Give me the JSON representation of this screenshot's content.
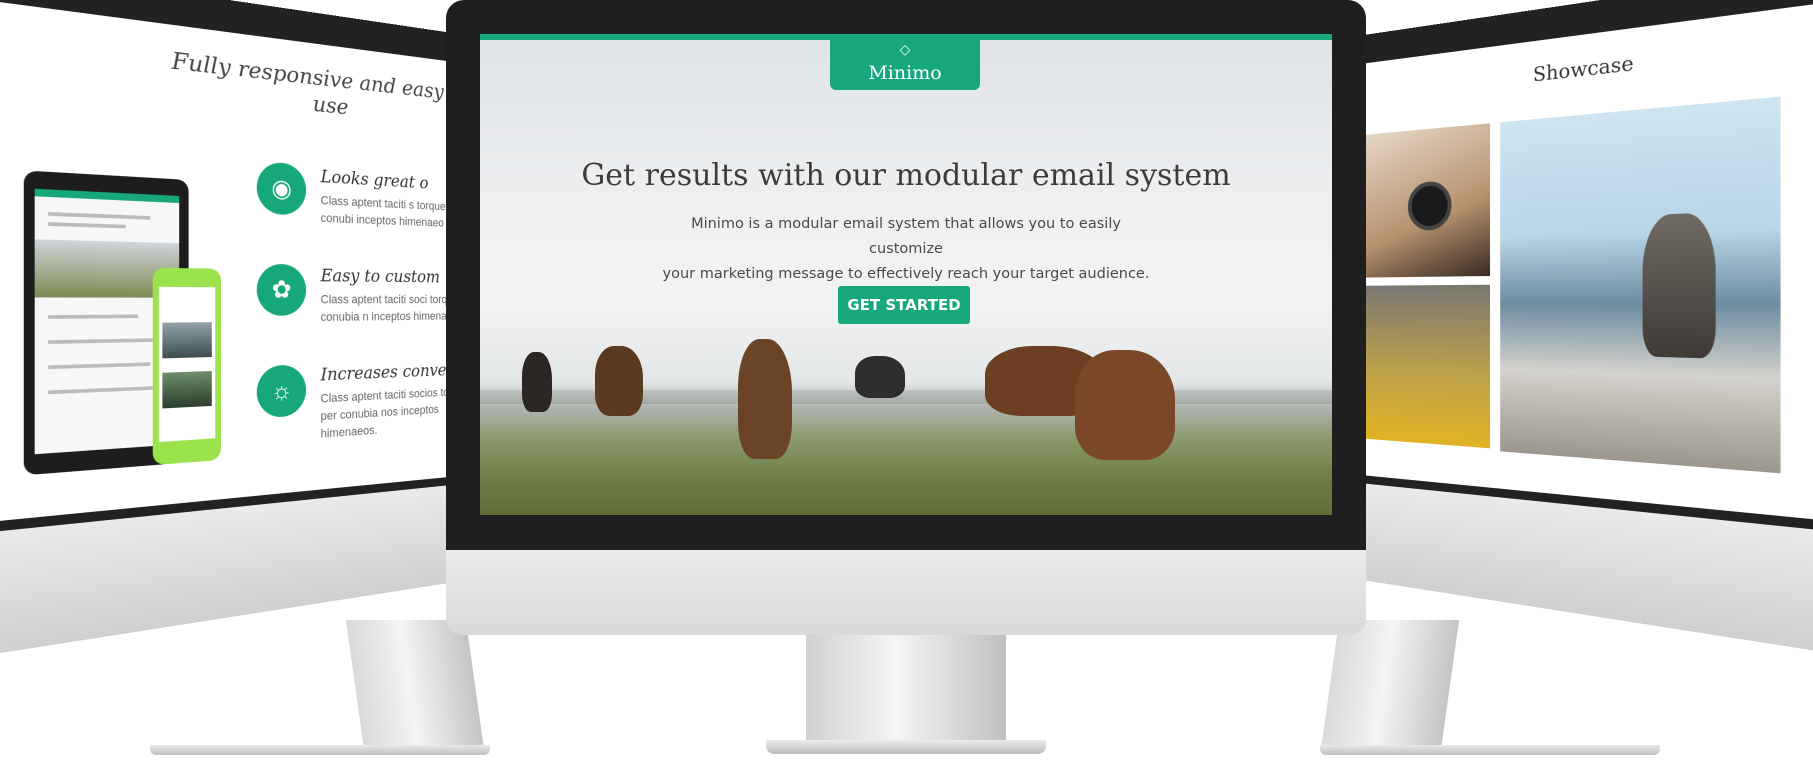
{
  "center_screen": {
    "logo": {
      "icon": "diamond-icon",
      "name": "Minimo"
    },
    "headline": "Get results with our modular email system",
    "description_line1": "Minimo is a modular email system that allows you to easily customize",
    "description_line2": "your marketing message to effectively reach your target audience.",
    "cta_label": "GET STARTED"
  },
  "left_screen": {
    "title": "Fully responsive and easy to use",
    "features": [
      {
        "icon": "globe-icon",
        "heading": "Looks great o",
        "text": "Class aptent taciti s torquent per conubi inceptos himenaeo"
      },
      {
        "icon": "palette-icon",
        "heading": "Easy to custom",
        "text": "Class aptent taciti soci torquent per conubia n inceptos himenaeos."
      },
      {
        "icon": "lightbulb-icon",
        "heading": "Increases convers",
        "text": "Class aptent taciti socios torquent per conubia nos inceptos himenaeos."
      }
    ]
  },
  "right_screen": {
    "title": "Showcase"
  },
  "colors": {
    "accent": "#16a77a",
    "bezel": "#1f1f1f",
    "headline": "#3c3c3c"
  }
}
